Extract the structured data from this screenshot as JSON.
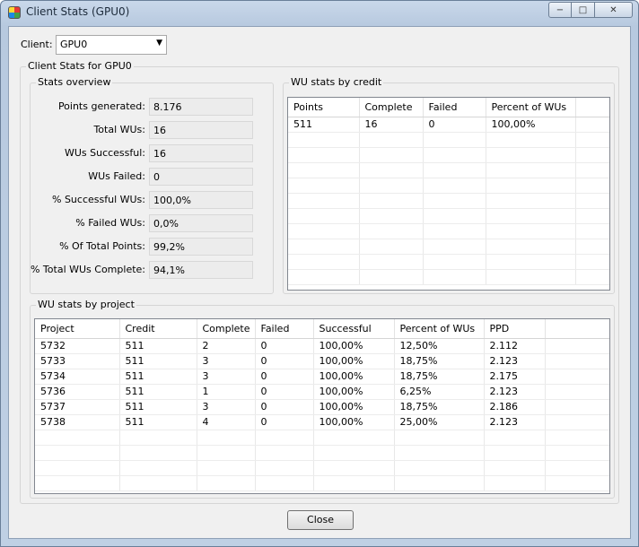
{
  "window": {
    "title": "Client Stats (GPU0)"
  },
  "client": {
    "label": "Client:",
    "selected": "GPU0"
  },
  "stats_group_title": "Client Stats for GPU0",
  "overview": {
    "title": "Stats overview",
    "rows": [
      {
        "label": "Points generated:",
        "value": "8.176"
      },
      {
        "label": "Total WUs:",
        "value": "16"
      },
      {
        "label": "WUs Successful:",
        "value": "16"
      },
      {
        "label": "WUs Failed:",
        "value": "0"
      },
      {
        "label": "% Successful WUs:",
        "value": "100,0%"
      },
      {
        "label": "% Failed WUs:",
        "value": "0,0%"
      },
      {
        "label": "% Of Total Points:",
        "value": "99,2%"
      },
      {
        "label": "% Total WUs Complete:",
        "value": "94,1%"
      }
    ]
  },
  "credit": {
    "title": "WU stats by credit",
    "columns": [
      "Points",
      "Complete",
      "Failed",
      "Percent of WUs"
    ],
    "rows": [
      [
        "511",
        "16",
        "0",
        "100,00%"
      ]
    ]
  },
  "project": {
    "title": "WU stats by project",
    "columns": [
      "Project",
      "Credit",
      "Complete",
      "Failed",
      "Successful",
      "Percent of WUs",
      "PPD"
    ],
    "rows": [
      [
        "5732",
        "511",
        "2",
        "0",
        "100,00%",
        "12,50%",
        "2.112"
      ],
      [
        "5733",
        "511",
        "3",
        "0",
        "100,00%",
        "18,75%",
        "2.123"
      ],
      [
        "5734",
        "511",
        "3",
        "0",
        "100,00%",
        "18,75%",
        "2.175"
      ],
      [
        "5736",
        "511",
        "1",
        "0",
        "100,00%",
        "6,25%",
        "2.123"
      ],
      [
        "5737",
        "511",
        "3",
        "0",
        "100,00%",
        "18,75%",
        "2.186"
      ],
      [
        "5738",
        "511",
        "4",
        "0",
        "100,00%",
        "25,00%",
        "2.123"
      ]
    ]
  },
  "buttons": {
    "close": "Close"
  }
}
